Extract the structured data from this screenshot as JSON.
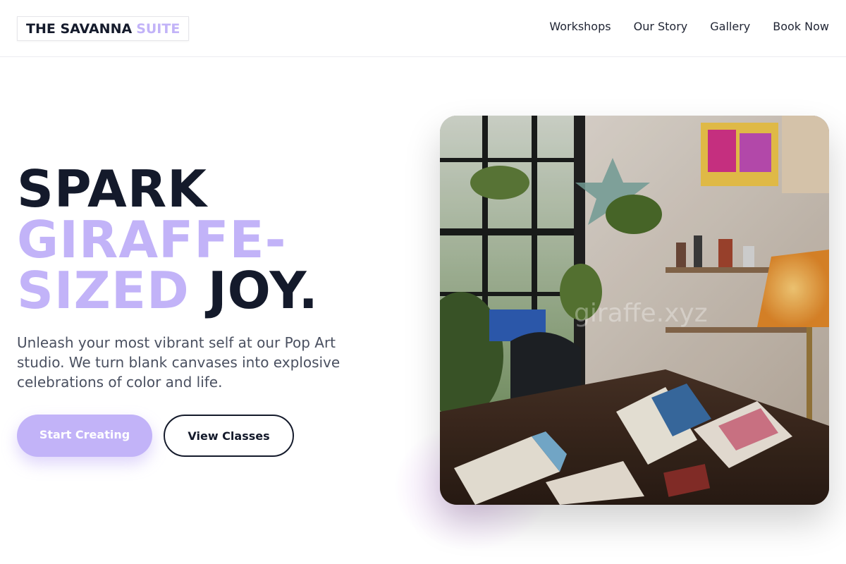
{
  "brand": {
    "name": "THE SAVANNA",
    "accent": "SUITE"
  },
  "nav": {
    "items": [
      "Workshops",
      "Our Story",
      "Gallery",
      "Book Now"
    ]
  },
  "hero": {
    "title_line1": "SPARK",
    "title_line2": "GIRAFFE-",
    "title_line3_accent": "SIZED",
    "title_line3_dark": "JOY.",
    "tagline": "Unleash your most vibrant self at our Pop Art studio. We turn blank canvases into explosive celebrations of color and life.",
    "primary_cta": "Start Creating",
    "secondary_cta": "View Classes",
    "image_watermark": "giraffe.xyz"
  },
  "colors": {
    "accent": "#c2b3f8",
    "dark": "#141a2b",
    "body_text": "#4a5060"
  },
  "icons": {
    "hero_image": "art-studio-photo"
  }
}
